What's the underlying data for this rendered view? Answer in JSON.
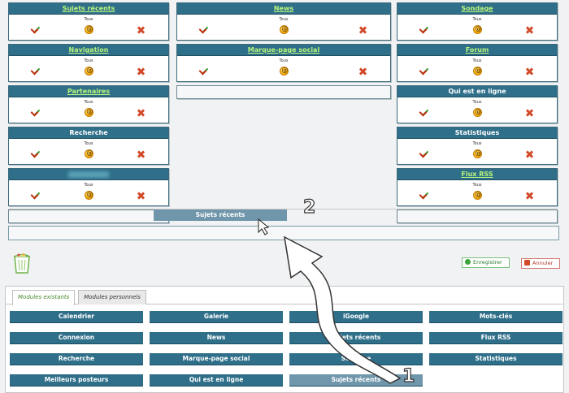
{
  "left_column": [
    {
      "title": "Sujets récents",
      "link": true,
      "sub": "Tous"
    },
    {
      "title": "Navigation",
      "link": true,
      "sub": "Tous"
    },
    {
      "title": "Partenaires",
      "link": true,
      "sub": "Tous"
    },
    {
      "title": "Recherche",
      "link": false,
      "sub": "Tous"
    },
    {
      "title": "",
      "link": false,
      "blurred": true,
      "sub": "Tous"
    }
  ],
  "middle_column": [
    {
      "title": "News",
      "link": true,
      "sub": "Tous"
    },
    {
      "title": "Marque-page social",
      "link": true,
      "sub": "Tous"
    }
  ],
  "right_column": [
    {
      "title": "Sondage",
      "link": true,
      "sub": "Tous"
    },
    {
      "title": "Forum",
      "link": true,
      "sub": "Tous"
    },
    {
      "title": "Qui est en ligne",
      "link": false,
      "sub": "Tous"
    },
    {
      "title": "Statistiques",
      "link": false,
      "sub": "Tous"
    },
    {
      "title": "Flux RSS",
      "link": true,
      "sub": "Tous"
    }
  ],
  "drag": {
    "label": "Sujets récents"
  },
  "buttons": {
    "save": "Enregistrer",
    "cancel": "Annuler"
  },
  "tabs": [
    {
      "label": "Modules existants",
      "active": true
    },
    {
      "label": "Modules personnels",
      "active": false
    }
  ],
  "modules": [
    "Calendrier",
    "Galerie",
    "iGoogle",
    "Mots-clés",
    "Connexion",
    "News",
    "Sujets récents",
    "Flux RSS",
    "Recherche",
    "Marque-page social",
    "Sondage",
    "Statistiques",
    "Meilleurs posteurs",
    "Qui est en ligne",
    "Sujets récents"
  ],
  "annotations": {
    "step1": "1",
    "step2": "2"
  },
  "colors": {
    "header": "#2f6f89",
    "link": "#b8f57a",
    "ghost": "#7096ab"
  }
}
